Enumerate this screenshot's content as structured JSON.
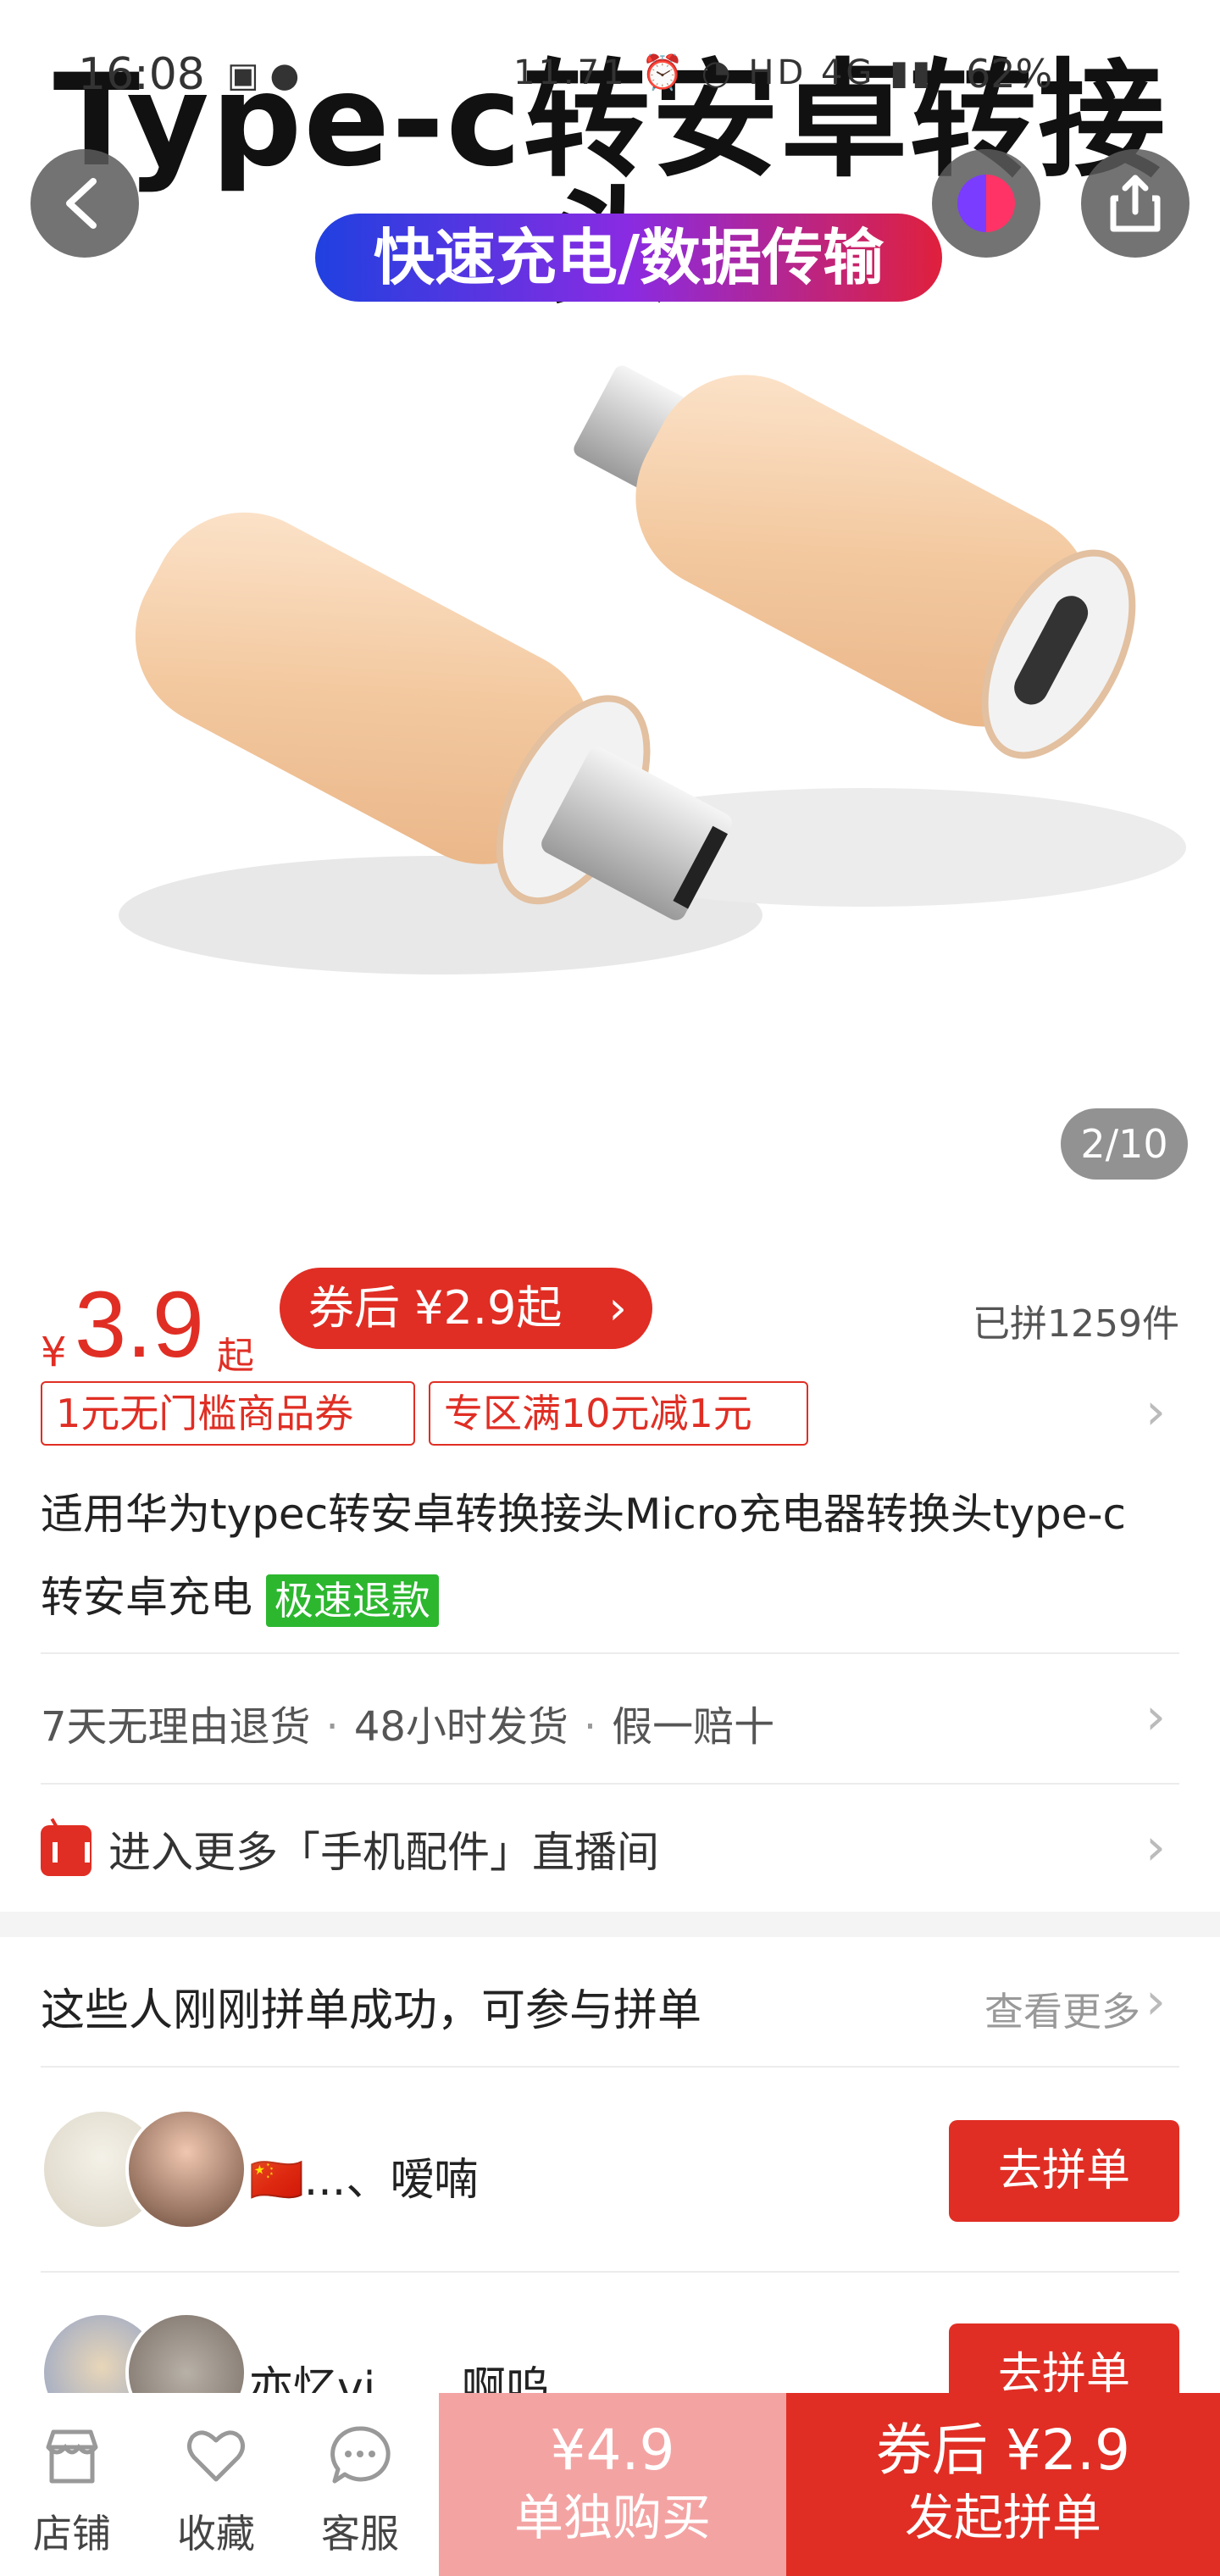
{
  "status_bar": {
    "time": "16:08",
    "network_speed": "11.71",
    "network_right": "HD 4G",
    "battery": "62%"
  },
  "hero": {
    "title": "Type-c转安卓转接头",
    "banner": "快速充电/数据传输",
    "page_counter": "2/10"
  },
  "price": {
    "currency": "¥",
    "amount": "3.9",
    "suffix": "起",
    "coupon_label": "券后 ¥2.9起",
    "sold": "已拼1259件"
  },
  "tags": [
    "1元无门槛商品券",
    "专区满10元减1元"
  ],
  "product_title": "适用华为typec转安卓转换接头Micro充电器转换头type-c转安卓充电",
  "refund_badge": "极速退款",
  "services": [
    "7天无理由退货",
    "48小时发货",
    "假一赔十"
  ],
  "service_separator": "·",
  "live_entry": "进入更多「手机配件」直播间",
  "group_buy": {
    "heading": "这些人刚刚拼单成功，可参与拼单",
    "see_more": "查看更多",
    "rows": [
      {
        "names": "🇨🇳...、嗳喃",
        "button": "去拼单"
      },
      {
        "names": "亦忆vi...、啊呜",
        "button": "去拼单"
      }
    ]
  },
  "bottom_bar": {
    "store": "店铺",
    "favorite": "收藏",
    "service": "客服",
    "solo_price": "¥4.9",
    "solo_action": "单独购买",
    "group_price": "券后 ¥2.9",
    "group_action": "发起拼单"
  },
  "colors": {
    "brand_red": "#e02e24",
    "solo_pink": "#f4a3a3",
    "refund_green": "#2cb72f"
  },
  "icons": [
    "back-icon",
    "share-icon",
    "store-icon",
    "heart-icon",
    "chat-icon",
    "live-icon",
    "chevron-right-icon"
  ]
}
